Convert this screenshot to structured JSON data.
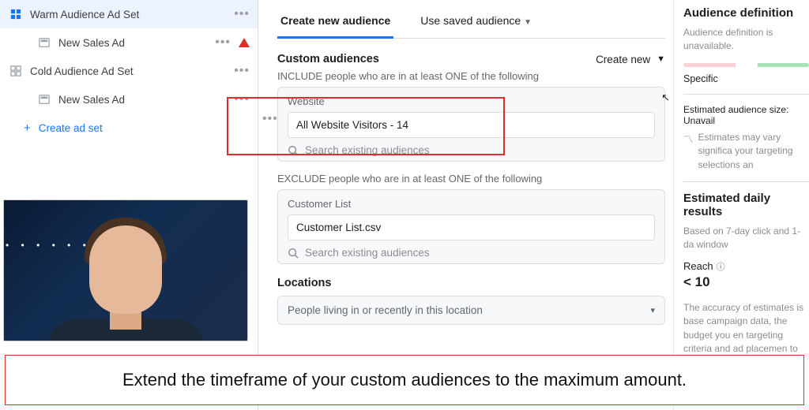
{
  "sidebar": {
    "items": [
      {
        "label": "Warm Audience Ad Set"
      },
      {
        "label": "New Sales Ad"
      },
      {
        "label": "Cold Audience Ad Set"
      },
      {
        "label": "New Sales Ad"
      }
    ],
    "create_label": "Create ad set"
  },
  "tabs": {
    "create": "Create new audience",
    "saved": "Use saved audience"
  },
  "custom_audiences": {
    "title": "Custom audiences",
    "create_new": "Create new",
    "include_text": "INCLUDE people who are in at least ONE of the following",
    "include_card_label": "Website",
    "include_pill": "All Website Visitors - 14",
    "search_placeholder": "Search existing audiences",
    "exclude_text": "EXCLUDE people who are in at least ONE of the following",
    "exclude_card_label": "Customer List",
    "exclude_pill": "Customer List.csv"
  },
  "locations": {
    "title": "Locations",
    "field_value": "People living in or recently in this location"
  },
  "right": {
    "def_title": "Audience definition",
    "def_unavailable": "Audience definition is unavailable.",
    "specific": "Specific",
    "size_label": "Estimated audience size: Unavail",
    "size_note": "Estimates may vary significa your targeting selections an",
    "est_title": "Estimated daily results",
    "est_sub": "Based on 7-day click and 1-da window",
    "reach_label": "Reach",
    "reach_value": "< 10",
    "disclaimer": "The accuracy of estimates is base campaign data, the budget you en targeting criteria and ad placemen to give you an idea of performanc only estimates and don't guarante"
  },
  "caption": "Extend the timeframe of your custom audiences to the maximum amount."
}
